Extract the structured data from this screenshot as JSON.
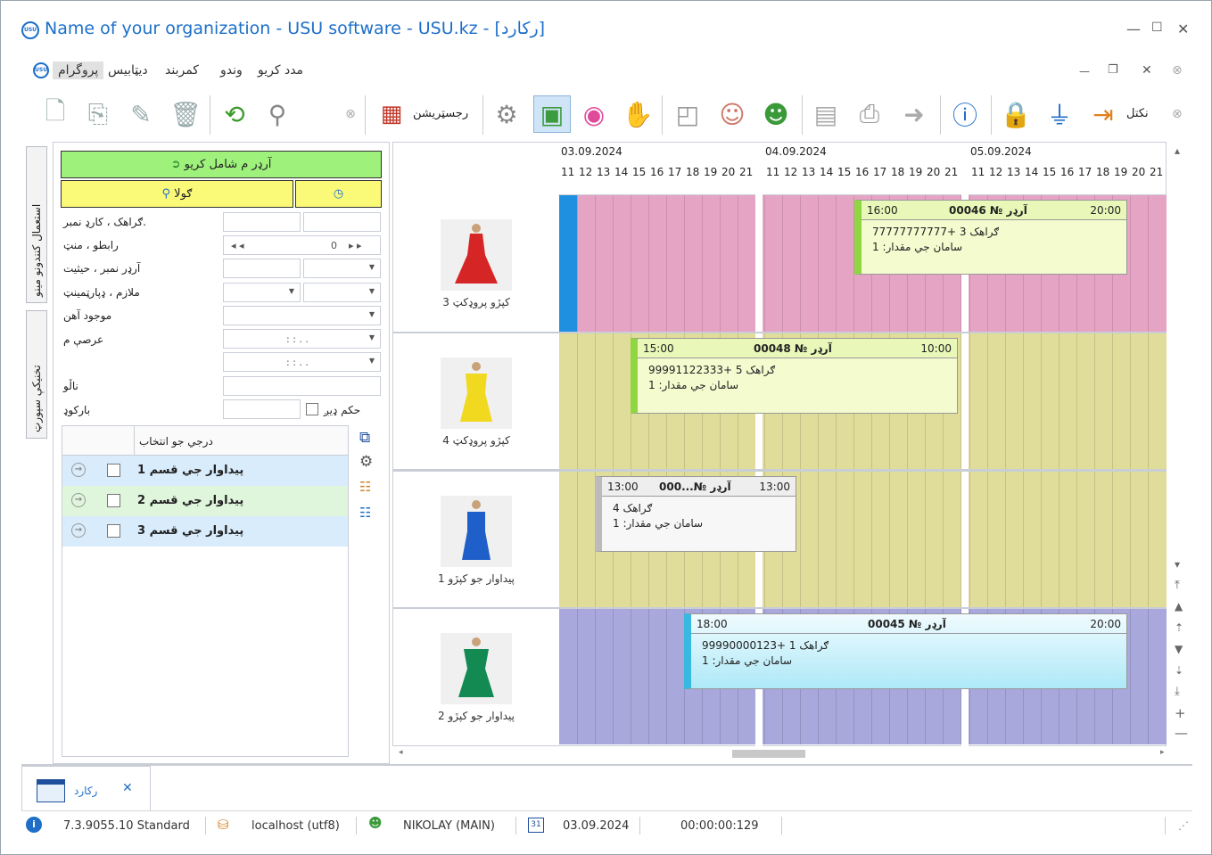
{
  "window": {
    "title": "Name of your organization - USU software - USU.kz - [ركارد]",
    "logo_text": "USU"
  },
  "menu": {
    "items": [
      "پروگرام",
      "ديټابيس",
      "کمربند",
      "وندو",
      "مدد کريو"
    ]
  },
  "toolbar": {
    "journal_label": "رجسټريشن",
    "exit_label": "نکتل"
  },
  "sidetabs": [
    "استعمال کنندونو مینو",
    "تخنیکې سپورټ"
  ],
  "form": {
    "green_button": "آرډر م شامل کريو",
    "search_button": "ګولا",
    "fields": [
      {
        "label": "ګراهک ، کارډ نمبر.",
        "value": ""
      },
      {
        "label": "رابطو ، منټ",
        "value": "0"
      },
      {
        "label": "آرډر نمبر ، حيثيت",
        "value": ""
      },
      {
        "label": "ملازم ، ډپارټمينټ",
        "value": ""
      },
      {
        "label": "موجود آهن",
        "value": ""
      },
      {
        "label": "عرصې م",
        "value": ": :     . ."
      },
      {
        "label": "",
        "value": ": :     . ."
      },
      {
        "label": "ناڵو",
        "value": ""
      },
      {
        "label": "بارکوډ",
        "value": ""
      }
    ],
    "checkbox_label": "حکم ډيږ"
  },
  "list": {
    "header": "درجي جو انتخاب",
    "rows": [
      {
        "label": "1 پيداوار جي قسم",
        "color": "#d9ecfb"
      },
      {
        "label": "2 پيداوار جي قسم",
        "color": "#dff5dc"
      },
      {
        "label": "3 پيداوار جي قسم",
        "color": "#d9ecfb"
      }
    ]
  },
  "schedule": {
    "dates": [
      "03.09.2024",
      "04.09.2024",
      "05.09.2024"
    ],
    "hours": [
      "11",
      "12",
      "13",
      "14",
      "15",
      "16",
      "17",
      "18",
      "19",
      "20",
      "21"
    ],
    "rows": [
      {
        "product": "3 کپڙو پروډکټ",
        "color": "#e6a4c4",
        "dress": "#d62525"
      },
      {
        "product": "4 کپڙو پروډکټ",
        "color": "#e0dc9a",
        "dress": "#f0d91f"
      },
      {
        "product": "1 پيداوار جو کپڙو",
        "color": "#e0dc9a",
        "dress": "#1f5fc9"
      },
      {
        "product": "2 پيداوار جو کپڙو",
        "color": "#a8a8dc",
        "dress": "#128a52"
      }
    ],
    "cards": [
      {
        "start": "16:00",
        "title": "آرډر № 00046",
        "end": "20:00",
        "line2": "ګراهک 3 +77777777777",
        "line3": "سامان جي مقدار: 1"
      },
      {
        "start": "15:00",
        "title": "آرډر № 00048",
        "end": "10:00",
        "line2": "ګراهک 5 +99991122333",
        "line3": "سامان جي مقدار: 1"
      },
      {
        "start": "13:00",
        "title": "آرډر №...000",
        "end": "13:00",
        "line2": "ګراهک 4",
        "line3": "سامان جي مقدار: 1"
      },
      {
        "start": "18:00",
        "title": "آرډر № 00045",
        "end": "20:00",
        "line2": "ګراهک 1 +99990000123",
        "line3": "سامان جي مقدار: 1"
      }
    ]
  },
  "bottom_tab": {
    "label": "ركارد"
  },
  "status": {
    "version": "7.3.9055.10 Standard",
    "db": "localhost (utf8)",
    "user": "NIKOLAY (MAIN)",
    "date": "03.09.2024",
    "timer": "00:00:00:129"
  }
}
